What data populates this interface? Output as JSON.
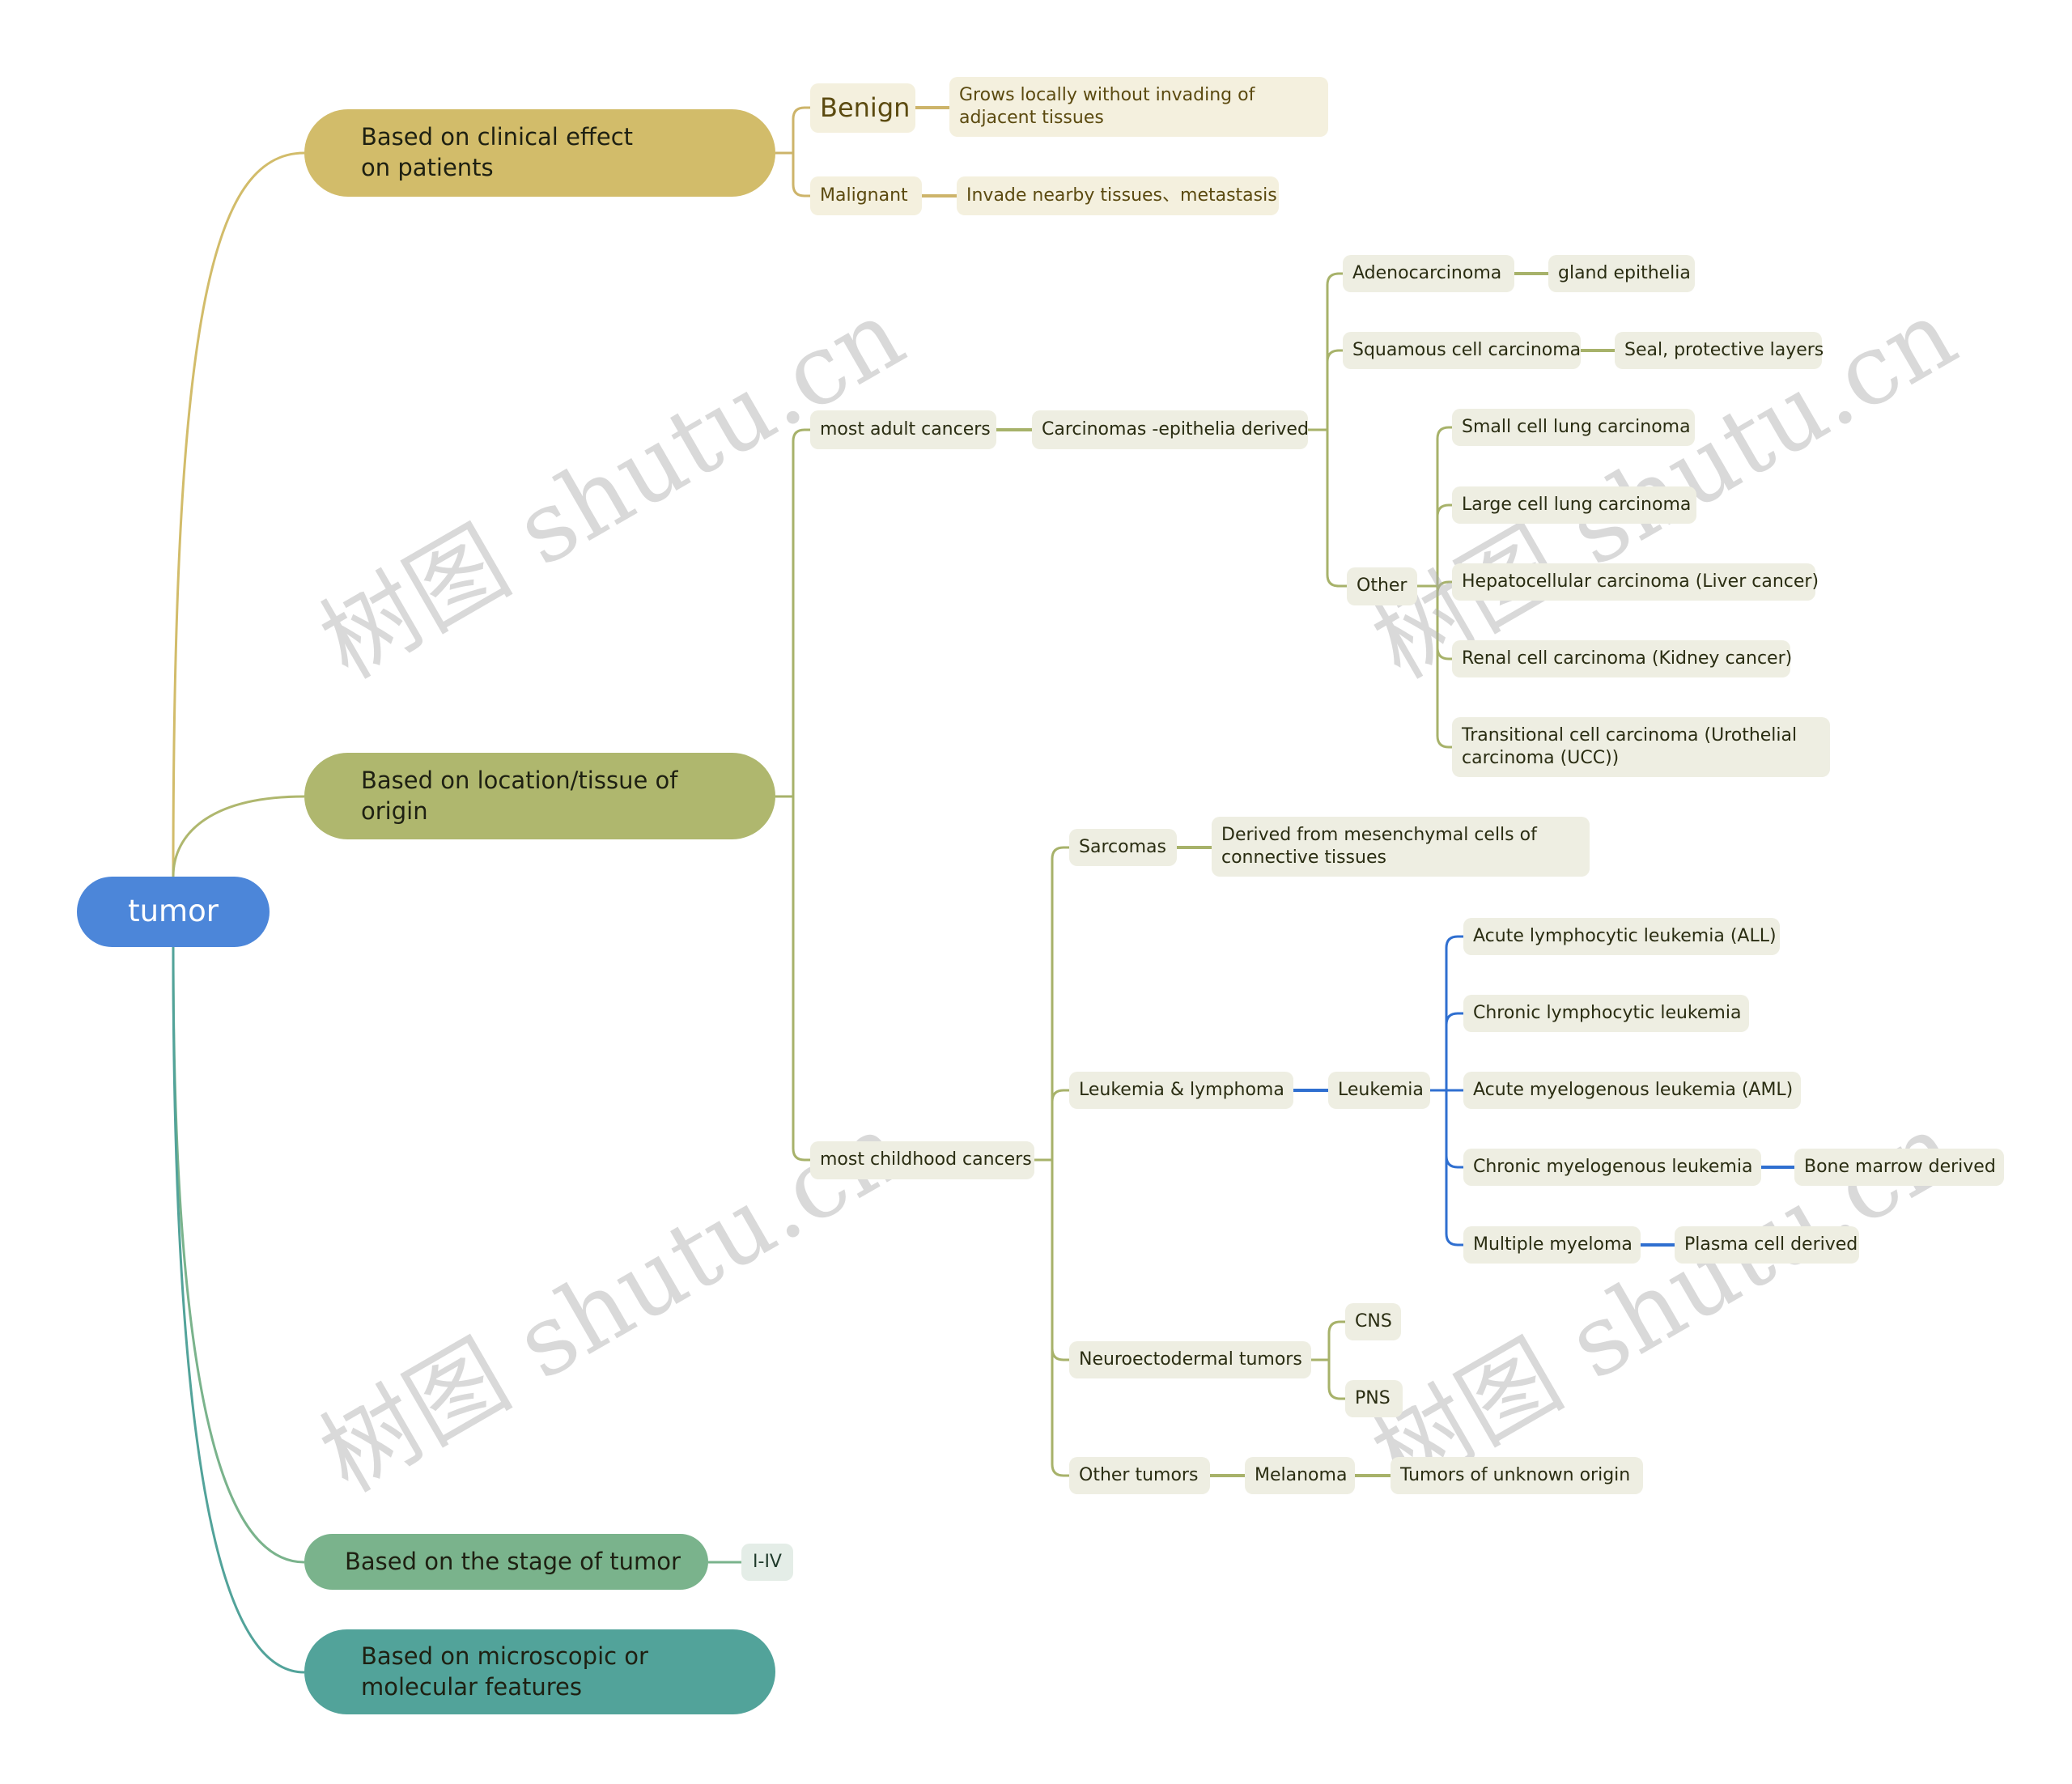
{
  "root": {
    "label": "tumor"
  },
  "branches": {
    "clinical": {
      "label": "Based on clinical effect on patients",
      "benign": {
        "label": "Benign",
        "detail": "Grows locally without invading of adjacent tissues"
      },
      "malignant": {
        "label": "Malignant",
        "detail": "Invade nearby tissues、metastasis"
      }
    },
    "location": {
      "label": "Based on location/tissue of origin",
      "adult": {
        "label": "most adult cancers",
        "carcinomas": {
          "label": "Carcinomas -epithelia derived",
          "adeno": {
            "label": "Adenocarcinoma",
            "detail": "gland epithelia"
          },
          "squamous": {
            "label": "Squamous cell carcinoma",
            "detail": "Seal, protective layers"
          },
          "other": {
            "label": "Other",
            "items": [
              "Small cell lung carcinoma",
              "Large cell lung carcinoma",
              "Hepatocellular carcinoma (Liver cancer)",
              "Renal cell carcinoma (Kidney cancer)",
              "Transitional cell carcinoma (Urothelial carcinoma (UCC))"
            ]
          }
        }
      },
      "childhood": {
        "label": "most childhood cancers",
        "sarcomas": {
          "label": "Sarcomas",
          "detail": "Derived from mesenchymal cells of connective tissues"
        },
        "leukemia_lymphoma": {
          "label": "Leukemia & lymphoma",
          "leukemia": {
            "label": "Leukemia",
            "items": [
              {
                "label": "Acute lymphocytic leukemia (ALL)"
              },
              {
                "label": "Chronic lymphocytic leukemia"
              },
              {
                "label": "Acute myelogenous leukemia (AML)"
              },
              {
                "label": "Chronic myelogenous leukemia",
                "detail": "Bone marrow derived"
              },
              {
                "label": "Multiple myeloma",
                "detail": "Plasma cell derived"
              }
            ]
          }
        },
        "neuro": {
          "label": "Neuroectodermal tumors",
          "items": [
            "CNS",
            "PNS"
          ]
        },
        "other_tumors": {
          "label": "Other tumors",
          "melanoma": "Melanoma",
          "unknown": "Tumors of unknown origin"
        }
      }
    },
    "stage": {
      "label": "Based on the stage of tumor",
      "detail": "I-IV"
    },
    "microscopic": {
      "label": "Based on microscopic or molecular features"
    }
  },
  "watermark": "树图 shutu.cn",
  "colors": {
    "root": "#4C86D9",
    "clinical": "#D2BC6A",
    "location": "#AFB76E",
    "stage": "#7AB38C",
    "microscopic": "#52A39A",
    "leukemia_links": "#2F6FD0"
  }
}
